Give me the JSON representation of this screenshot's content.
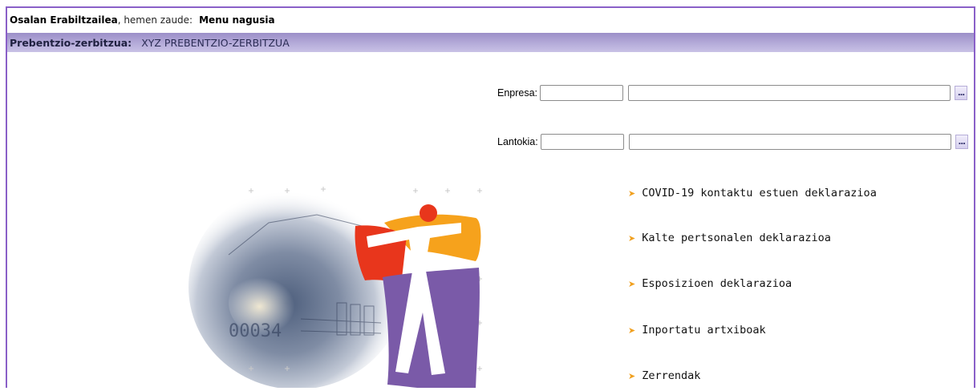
{
  "header": {
    "user_name": "Osalan Erabiltzailea",
    "location_prefix": ", hemen zaude:",
    "location_current": "Menu nagusia"
  },
  "subheader": {
    "label": "Prebentzio-zerbitzua:",
    "value": "XYZ PREBENTZIO-ZERBITZUA"
  },
  "form": {
    "enpresa": {
      "label": "Enpresa:",
      "code_value": "",
      "name_value": "",
      "lookup_label": "..."
    },
    "lantokia": {
      "label": "Lantokia:",
      "code_value": "",
      "name_value": "",
      "lookup_label": "..."
    }
  },
  "menu": {
    "items": [
      {
        "label": "COVID-19 kontaktu estuen deklarazioa"
      },
      {
        "label": "Kalte pertsonalen deklarazioa"
      },
      {
        "label": "Esposizioen deklarazioa"
      },
      {
        "label": "Inportatu artxiboak"
      },
      {
        "label": "Zerrendak"
      }
    ]
  },
  "logo": {
    "icon": "osalan-logo-collage-icon",
    "decor_text": "00034"
  },
  "colors": {
    "frame_border": "#8a60c8",
    "subheader_bg": "#b0a6d6",
    "menu_arrow": "#f0a020",
    "logo_red": "#e8361c",
    "logo_orange": "#f6a21c",
    "logo_purple": "#7a5aa8"
  }
}
